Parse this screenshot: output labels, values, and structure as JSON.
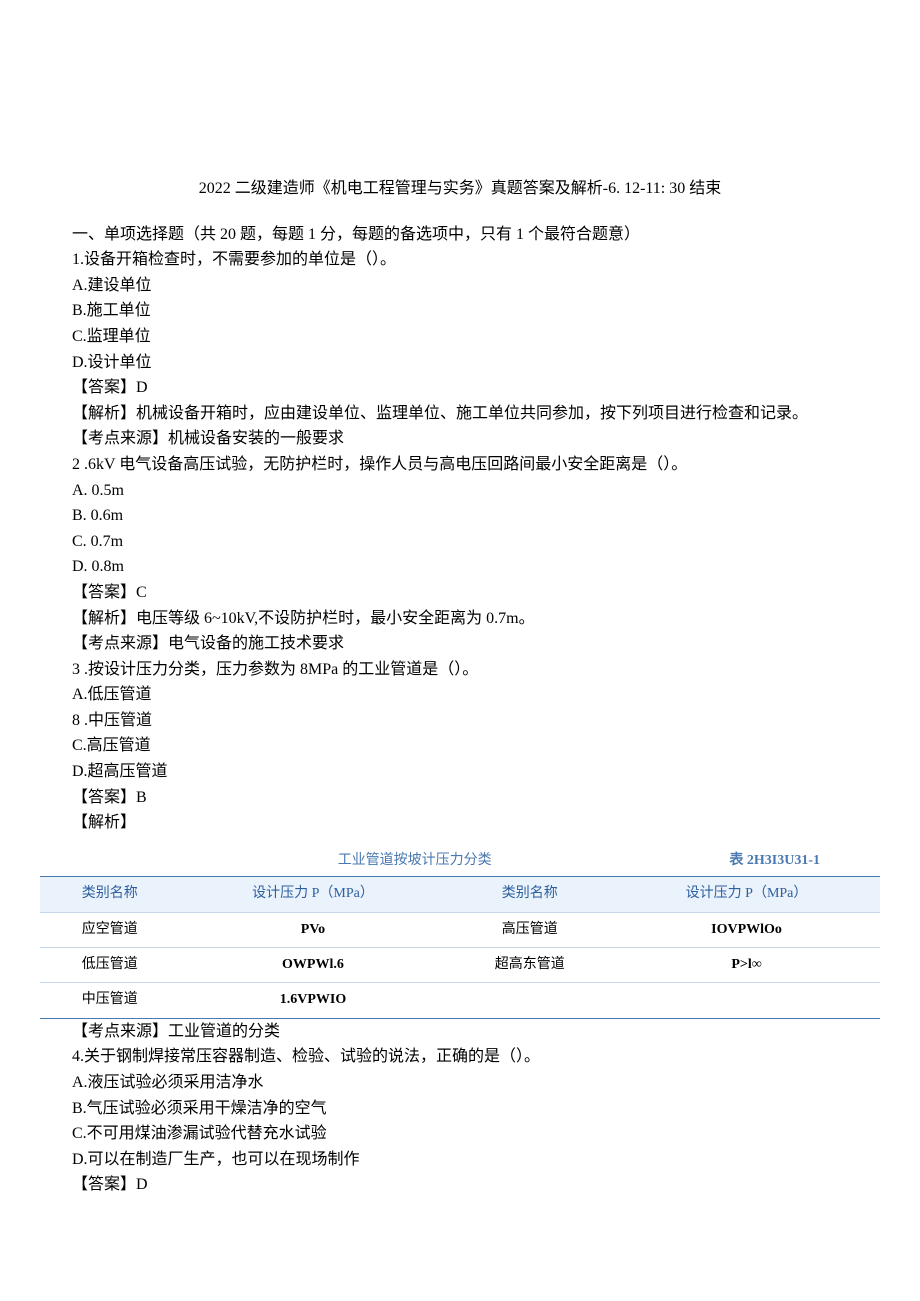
{
  "title": "2022 二级建造师《机电工程管理与实务》真题答案及解析-6. 12-11: 30 结束",
  "section1_header": "一、单项选择题（共 20 题，每题 1 分，每题的备选项中，只有 1 个最符合题意）",
  "q1": {
    "stem": "1.设备开箱检查时，不需要参加的单位是（）。",
    "optA": "A.建设单位",
    "optB": "B.施工单位",
    "optC": "C.监理单位",
    "optD": "D.设计单位",
    "answer": "【答案】D",
    "analysis": "【解析】机械设备开箱时，应由建设单位、监理单位、施工单位共同参加，按下列项目进行检查和记录。",
    "source": "【考点来源】机械设备安装的一般要求"
  },
  "q2": {
    "stem": "2 .6kV 电气设备高压试验，无防护栏时，操作人员与高电压回路间最小安全距离是（）。",
    "optA": "A. 0.5m",
    "optB": "B. 0.6m",
    "optC": "C. 0.7m",
    "optD": "D. 0.8m",
    "answer": "【答案】C",
    "analysis": "【解析】电压等级 6~10kV,不设防护栏时，最小安全距离为 0.7m。",
    "source": "【考点来源】电气设备的施工技术要求"
  },
  "q3": {
    "stem": "3 .按设计压力分类，压力参数为 8MPa 的工业管道是（）。",
    "optA": "A.低压管道",
    "optB": "8 .中压管道",
    "optC": "C.高压管道",
    "optD": "D.超高压管道",
    "answer": "【答案】B",
    "analysis": "【解析】",
    "source": "【考点来源】工业管道的分类"
  },
  "table": {
    "caption": "工业管道按坡计压力分类",
    "tag": "表 2H3I3U31-1",
    "headers": [
      "类别名称",
      "设计压力 P（MPa）",
      "类别名称",
      "设计压力 P（MPa）"
    ],
    "rows": [
      [
        "应空管道",
        "PVo",
        "高压管道",
        "IOVPWlOo"
      ],
      [
        "低压管道",
        "OWPWl.6",
        "超高东管道",
        "P>l∞"
      ],
      [
        "中压管道",
        "1.6VPWIO",
        "",
        ""
      ]
    ]
  },
  "q4": {
    "stem": "4.关于钢制焊接常压容器制造、检验、试验的说法，正确的是（）。",
    "optA": "A.液压试验必须采用洁净水",
    "optB": "B.气压试验必须采用干燥洁净的空气",
    "optC": "C.不可用煤油渗漏试验代替充水试验",
    "optD": "D.可以在制造厂生产，也可以在现场制作",
    "answer": "【答案】D"
  }
}
